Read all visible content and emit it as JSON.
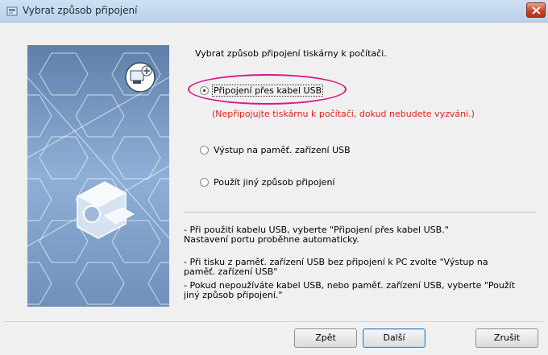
{
  "window": {
    "title": "Vybrat způsob připojení"
  },
  "heading": "Vybrat způsob připojení tiskárny k počítači.",
  "options": [
    {
      "label": "Připojení přes kabel USB",
      "selected": true
    },
    {
      "label": "Výstup na paměť. zařízení USB",
      "selected": false
    },
    {
      "label": "Použít jiný způsob připojení",
      "selected": false
    }
  ],
  "warning": "(Nepřipojujte tiskárnu k počítači, dokud nebudete vyzváni.)",
  "notes": {
    "n1_l1": "- Při použití kabelu USB, vyberte \"Připojení přes kabel USB.\"",
    "n1_l2": "Nastavení portu proběhne automaticky.",
    "n2_l1": "- Při tisku z paměť. zařízení USB bez připojení k PC zvolte \"Výstup na",
    "n2_l2": "paměť. zařízení USB\"",
    "n3_l1": "- Pokud nepoužíváte kabel USB, nebo paměť. zařízení USB, vyberte \"Použít",
    "n3_l2": "jiný způsob připojení.\""
  },
  "buttons": {
    "back": "Zpět",
    "next": "Další",
    "cancel": "Zrušit"
  },
  "colors": {
    "highlight_ellipse": "#d8168a",
    "warning_text": "#e02020",
    "art_background": "#6f8fb8"
  }
}
